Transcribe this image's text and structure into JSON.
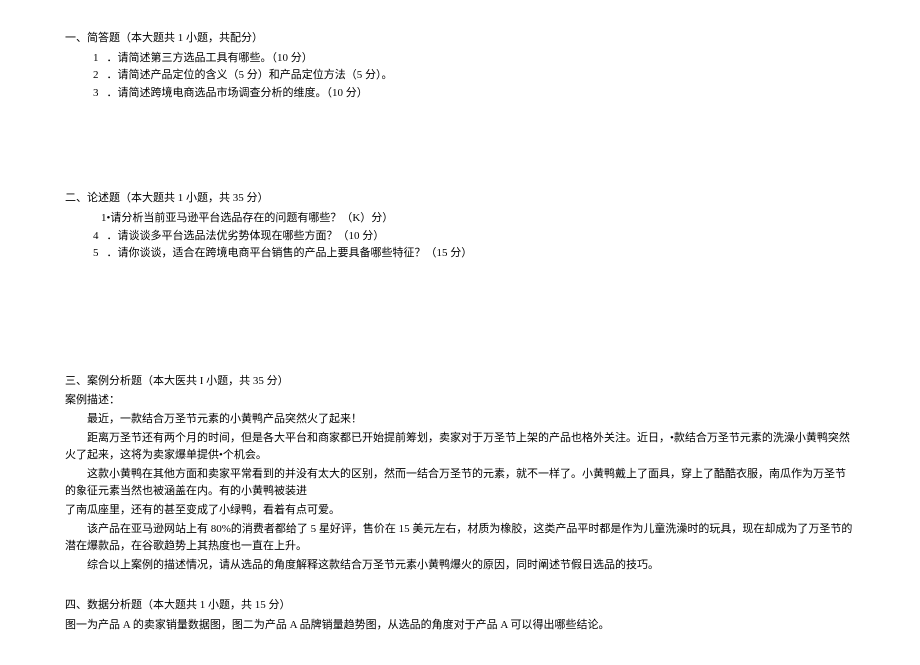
{
  "section1": {
    "heading": "一、简答题（本大题共 1 小题，共配分）",
    "items": [
      {
        "num": "1",
        "text": "．请简述第三方选品工具有哪些。（10 分）"
      },
      {
        "num": "2",
        "text": "．请简述产品定位的含义（5 分）和产品定位方法（5 分）。"
      },
      {
        "num": "3",
        "text": "．请简述跨境电商选品市场调查分析的维度。（10 分）"
      }
    ]
  },
  "section2": {
    "heading": "二、论述题（本大题共 1 小题，共 35 分）",
    "items": [
      {
        "num": "",
        "text": "1•请分析当前亚马逊平台选品存在的问题有哪些？（K）分）"
      },
      {
        "num": "4",
        "text": "．请谈谈多平台选品法优劣势体现在哪些方面？（10 分）"
      },
      {
        "num": "5",
        "text": "．请你谈谈，适合在跨境电商平台销售的产品上要具备哪些特征？（15 分）"
      }
    ]
  },
  "section3": {
    "heading": "三、案例分析题（本大医共 I 小题，共 35 分）",
    "case_label": "案例描述：",
    "paras": [
      "最近，一款结合万圣节元素的小黄鸭产品突然火了起来！",
      "距离万圣节还有两个月的时间，但是各大平台和商家都已开始提前筹划，卖家对于万圣节上架的产品也格外关注。近日，•款结合万圣节元素的洗澡小黄鸭突然火了起来，这将为卖家爆单提供•个机会。",
      "这款小黄鸭在其他方面和卖家平常看到的并没有太大的区别，然而一结合万圣节的元素，就不一样了。小黄鸭戴上了面具，穿上了酷酷衣服，南瓜作为万圣节的象征元素当然也被涵盖在内。有的小黄鸭被装进",
      "了南瓜座里，还有的甚至变成了小绿鸭，看着有点可爱。",
      "该产品在亚马逊网站上有 80%的消费者都给了 5 星好评，售价在 15 美元左右，材质为橡胶，这类产品平时都是作为儿童洗澡时的玩具，现在却成为了万圣节的潜在爆款品，在谷歌趋势上其热度也一直在上升。",
      "综合以上案例的描述情况，请从选品的角度解释这款结合万圣节元素小黄鸭爆火的原因，同时阐述节假日选品的技巧。"
    ]
  },
  "section4": {
    "heading": "四、数据分析题（本大题共 1 小题，共 15 分）",
    "desc": "图一为产品 A 的卖家销量数据图，图二为产品 A 品牌销量趋势图，从选品的角度对于产品 A 可以得出哪些结论。"
  }
}
